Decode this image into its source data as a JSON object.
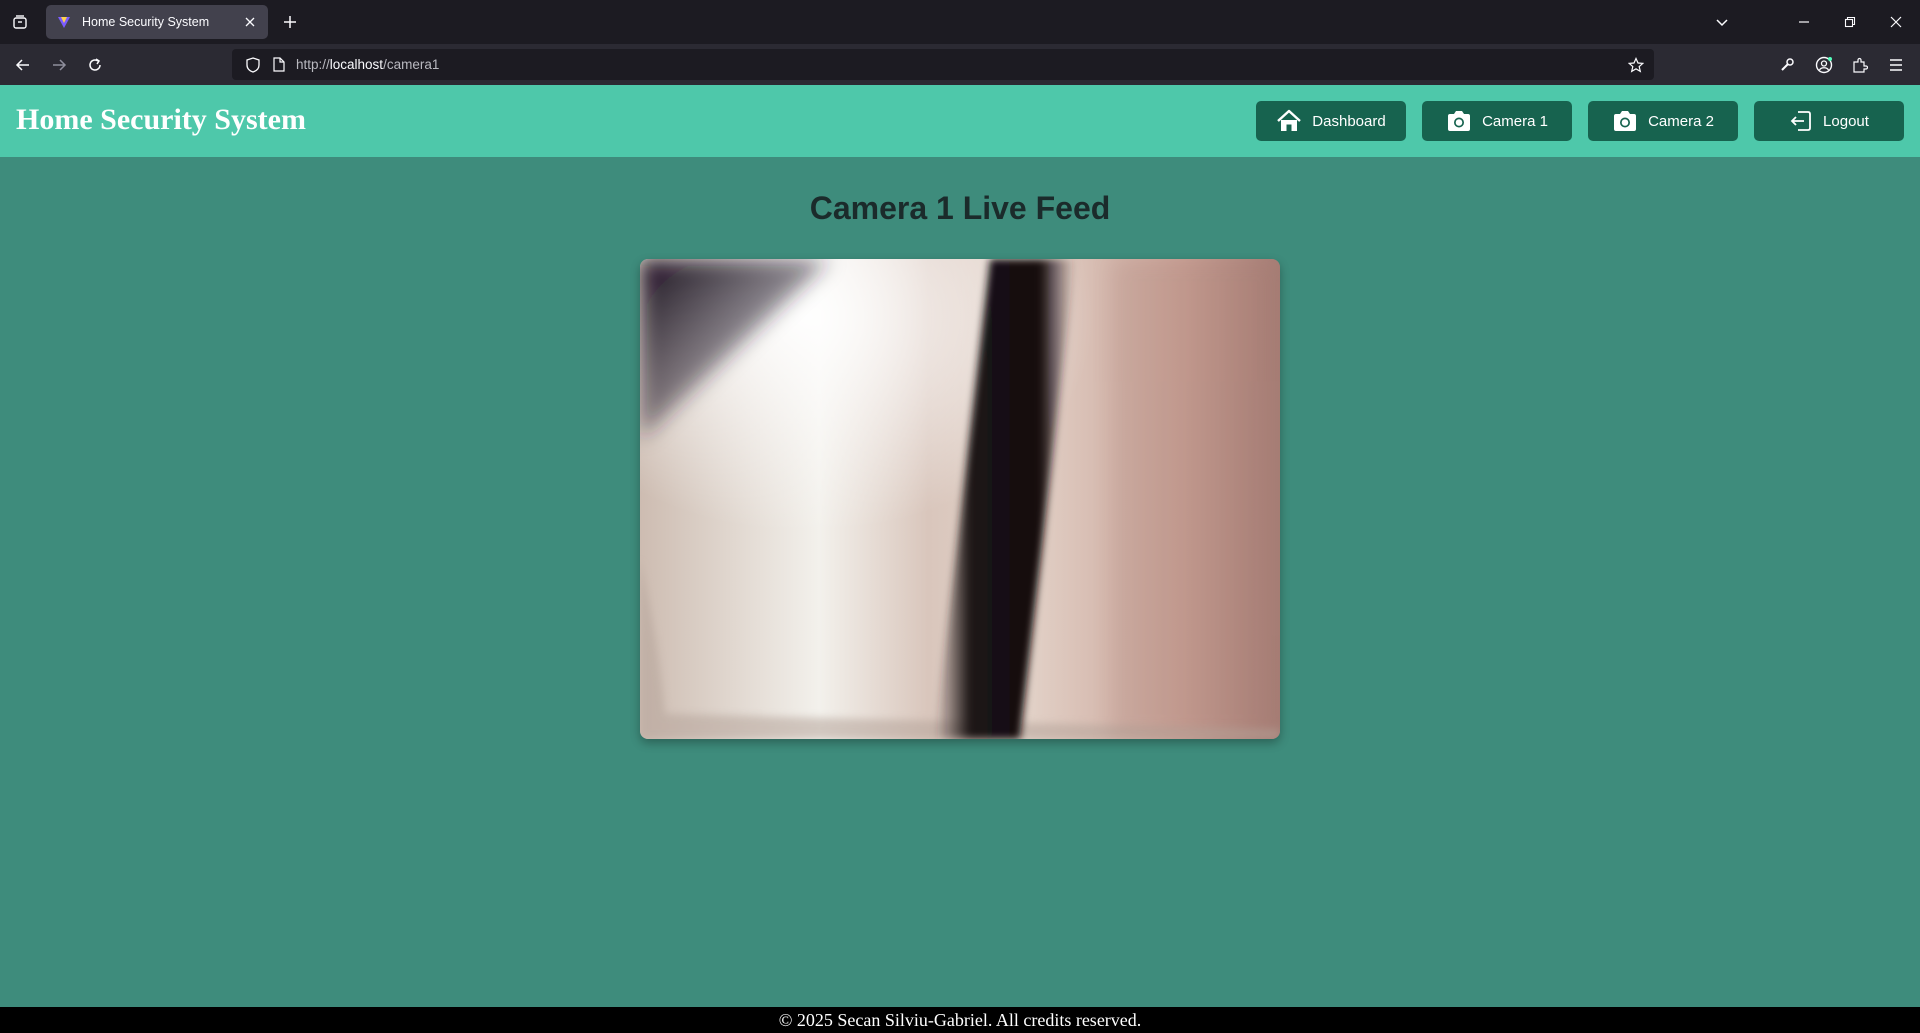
{
  "browser": {
    "tab_title": "Home Security System",
    "url_prefix": "http://",
    "url_host": "localhost",
    "url_path": "/camera1"
  },
  "header": {
    "brand": "Home Security System",
    "nav": {
      "dashboard": "Dashboard",
      "camera1": "Camera 1",
      "camera2": "Camera 2",
      "logout": "Logout"
    }
  },
  "main": {
    "title": "Camera 1 Live Feed"
  },
  "footer": {
    "text": "© 2025 Secan Silviu-Gabriel. All credits reserved."
  },
  "colors": {
    "header_bg": "#4ec8aa",
    "page_bg": "#3e8c7c",
    "button_bg": "#17634f",
    "footer_bg": "#000000"
  }
}
